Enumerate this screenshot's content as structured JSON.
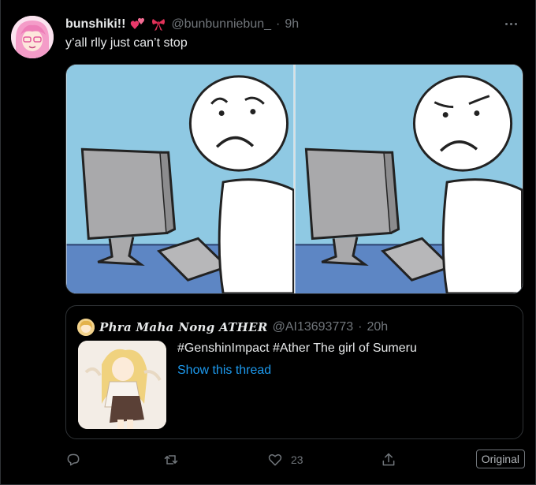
{
  "tweet": {
    "display_name": "bunshiki!!",
    "handle": "@bunbunniebun_",
    "separator": "·",
    "time": "9h",
    "text": "y’all rlly just can’t stop",
    "emojis": [
      "two-hearts-icon",
      "ribbon-icon"
    ]
  },
  "quote": {
    "display_name": "Phra Maha Nong ATHER",
    "handle": "@AI13693773",
    "separator": "·",
    "time": "20h",
    "text": "#GenshinImpact #Ather The girl of Sumeru",
    "link_label": "Show this thread"
  },
  "actions": {
    "reply_icon": "reply-icon",
    "retweet_icon": "retweet-icon",
    "like_icon": "heart-icon",
    "like_count": "23",
    "share_icon": "share-icon",
    "original_label": "Original"
  },
  "colors": {
    "background": "#000000",
    "text": "#e7e9ea",
    "muted": "#71767b",
    "link": "#1d9bf0",
    "border": "#2f3336"
  }
}
